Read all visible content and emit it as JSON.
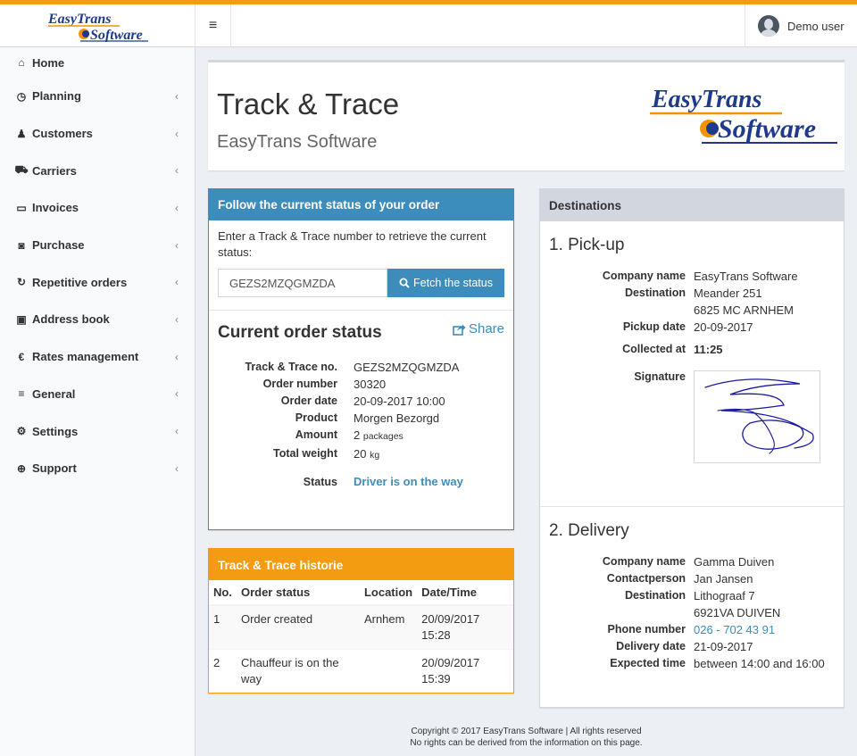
{
  "brand": {
    "logo_line1": "EasyTrans",
    "logo_line2": "Software"
  },
  "header": {
    "menu_toggle": "≡",
    "user_name": "Demo user"
  },
  "sidebar": {
    "items": [
      {
        "label": "Home",
        "icon": "⌂",
        "icon_name": "home-icon",
        "chevron": ""
      },
      {
        "label": "Planning",
        "icon": "◷",
        "icon_name": "clock-icon",
        "chevron": "‹"
      },
      {
        "label": "Customers",
        "icon": "♟",
        "icon_name": "user-icon",
        "chevron": "‹"
      },
      {
        "label": "Carriers",
        "icon": "⛟",
        "icon_name": "truck-icon",
        "chevron": "‹"
      },
      {
        "label": "Invoices",
        "icon": "▭",
        "icon_name": "credit-card-icon",
        "chevron": "‹"
      },
      {
        "label": "Purchase",
        "icon": "◙",
        "icon_name": "money-icon",
        "chevron": "‹"
      },
      {
        "label": "Repetitive orders",
        "icon": "↻",
        "icon_name": "refresh-icon",
        "chevron": "‹"
      },
      {
        "label": "Address book",
        "icon": "▣",
        "icon_name": "address-book-icon",
        "chevron": "‹"
      },
      {
        "label": "Rates management",
        "icon": "€",
        "icon_name": "euro-icon",
        "chevron": "‹"
      },
      {
        "label": "General",
        "icon": "≡",
        "icon_name": "bars-icon",
        "chevron": "‹"
      },
      {
        "label": "Settings",
        "icon": "⚙",
        "icon_name": "cogs-icon",
        "chevron": "‹"
      },
      {
        "label": "Support",
        "icon": "⊕",
        "icon_name": "life-ring-icon",
        "chevron": "‹"
      }
    ]
  },
  "page": {
    "title": "Track & Trace",
    "subtitle": "EasyTrans Software"
  },
  "follow": {
    "heading": "Follow the current status of your order",
    "intro": "Enter a Track & Trace number to retrieve the current status:",
    "input_value": "GEZS2MZQGMZDA",
    "fetch_label": "Fetch the status",
    "status_title": "Current order status",
    "share_label": "Share",
    "rows": [
      {
        "key": "Track & Trace no.",
        "value": "GEZS2MZQGMZDA"
      },
      {
        "key": "Order number",
        "value": "30320"
      },
      {
        "key": "Order date",
        "value": "20-09-2017 10:00"
      },
      {
        "key": "Product",
        "value": "Morgen Bezorgd"
      }
    ],
    "amount_key": "Amount",
    "amount_num": "2",
    "amount_unit": "packages",
    "weight_key": "Total weight",
    "weight_num": "20",
    "weight_unit": "kg",
    "status_key": "Status",
    "status_value": "Driver is on the way"
  },
  "history": {
    "heading": "Track & Trace historie",
    "columns": [
      "No.",
      "Order status",
      "Location",
      "Date/Time"
    ],
    "rows": [
      {
        "no": "1",
        "status": "Order created",
        "location": "Arnhem",
        "datetime": "20/09/2017 15:28"
      },
      {
        "no": "2",
        "status": "Chauffeur is on the way",
        "location": "",
        "datetime": "20/09/2017 15:39"
      }
    ]
  },
  "destinations": {
    "heading": "Destinations",
    "pickup": {
      "title": "1. Pick-up",
      "company_key": "Company name",
      "company": "EasyTrans Software",
      "destination_key": "Destination",
      "address1": "Meander 251",
      "address2": "6825 MC ARNHEM",
      "date_key": "Pickup date",
      "date": "20-09-2017",
      "collected_key": "Collected at",
      "collected": "11:25",
      "signature_key": "Signature"
    },
    "delivery": {
      "title": "2. Delivery",
      "company_key": "Company name",
      "company": "Gamma Duiven",
      "contact_key": "Contactperson",
      "contact": "Jan Jansen",
      "destination_key": "Destination",
      "address1": "Lithograaf 7",
      "address2": "6921VA DUIVEN",
      "phone_key": "Phone number",
      "phone": "026 - 702 43 91",
      "date_key": "Delivery date",
      "date": "21-09-2017",
      "expected_key": "Expected time",
      "expected": "between 14:00 and 16:00"
    }
  },
  "footer": {
    "line1": "Copyright © 2017 EasyTrans Software | All rights reserved",
    "line2": "No rights can be derived from the information on this page."
  },
  "colors": {
    "accent_orange": "#f39c12",
    "primary_blue": "#3c8dbc",
    "panel_grey": "#d2d6de",
    "logo_orange": "#f29400",
    "logo_blue": "#1f3a8c",
    "signature_ink": "#1a1aa0"
  }
}
